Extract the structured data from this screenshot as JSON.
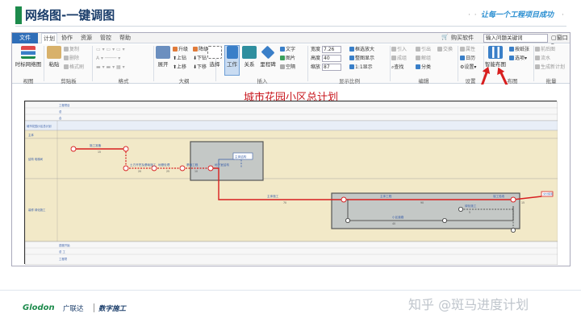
{
  "slide": {
    "title": "网络图-一键调图",
    "slogan": "让每一个工程项目成功",
    "slogan_dots": "· · ·",
    "slogan_dots_end": "·"
  },
  "menubar": {
    "file": "文件",
    "tabs": [
      "计划",
      "协作",
      "资源",
      "管控",
      "帮助"
    ],
    "buy": "购买软件",
    "search_placeholder": "输入问题关键词",
    "window": "窗口"
  },
  "ribbon": {
    "view": {
      "timescale": "时标网络图",
      "label": "视图"
    },
    "clipboard": {
      "paste": "粘贴",
      "copy": "复制",
      "delete": "删除",
      "format_painter": "格式刷",
      "label": "剪贴板"
    },
    "format": {
      "label": "格式"
    },
    "outline": {
      "expand": "展开",
      "upgrade": "升级",
      "downgrade": "降级",
      "up": "上钻",
      "down": "下钻",
      "move_up": "上移",
      "move_down": "下移",
      "label": "大纲"
    },
    "insert": {
      "select": "选择",
      "work": "工作",
      "relation": "关系",
      "milestone": "里程碑",
      "text": "文字",
      "image": "图片",
      "space": "空隔",
      "label": "插入"
    },
    "display": {
      "width_label": "宽度",
      "width": "7.26",
      "height_label": "高度",
      "height": "40",
      "zoom_label": "缩放",
      "zoom": "87",
      "fit_box": "框选放大",
      "full": "整图显示",
      "one_to_one": "1:1显示",
      "label": "显示比例"
    },
    "edit": {
      "link_in": "引入",
      "link_out": "引出",
      "swap": "交换",
      "group": "成组",
      "ungroup": "解组",
      "find": "查找",
      "classify": "分类",
      "label": "编辑"
    },
    "settings": {
      "property": "属性",
      "calendar": "日历",
      "settings": "设置",
      "label": "设置"
    },
    "layout": {
      "smart": "智能布图",
      "by_paper": "按纸张",
      "options": "选项",
      "label": "布图"
    },
    "batch": {
      "front_back": "前后图",
      "flow": "流水",
      "generate": "生成新计划",
      "label": "批量"
    }
  },
  "canvas": {
    "title": "城市花园小区总计划",
    "lanes": {
      "top": [
        "工程项目",
        "总",
        "合"
      ],
      "side_groups": [
        "城市花园小区总计划",
        "主体",
        "结构 电梯间",
        "装修 绿化施工"
      ],
      "bottom": [
        "进度开始",
        "总  工",
        "工程项"
      ]
    },
    "tasks": [
      "施工准备",
      "土方开挖及基础施工",
      "地基处理",
      "基础工程",
      "主体结构",
      "地下室结构",
      "主体施工",
      "主体工程",
      "装修工程",
      "竣工验收",
      "室外工程",
      "小区道路",
      "绿化施工",
      "交付使用"
    ],
    "nums": [
      "15",
      "20",
      "25",
      "10",
      "50",
      "70",
      "90",
      "40",
      "5",
      "15"
    ]
  },
  "footer": {
    "brand": "Glodon",
    "brand_cn": "广联达",
    "tagline": "数字施工",
    "watermark": "知乎 @斑马进度计划"
  },
  "colors": {
    "accent_green": "#1d8b4c",
    "title_navy": "#1a3d6a",
    "critical_red": "#d81f1f",
    "lane_yellow": "#f2e9c8"
  }
}
